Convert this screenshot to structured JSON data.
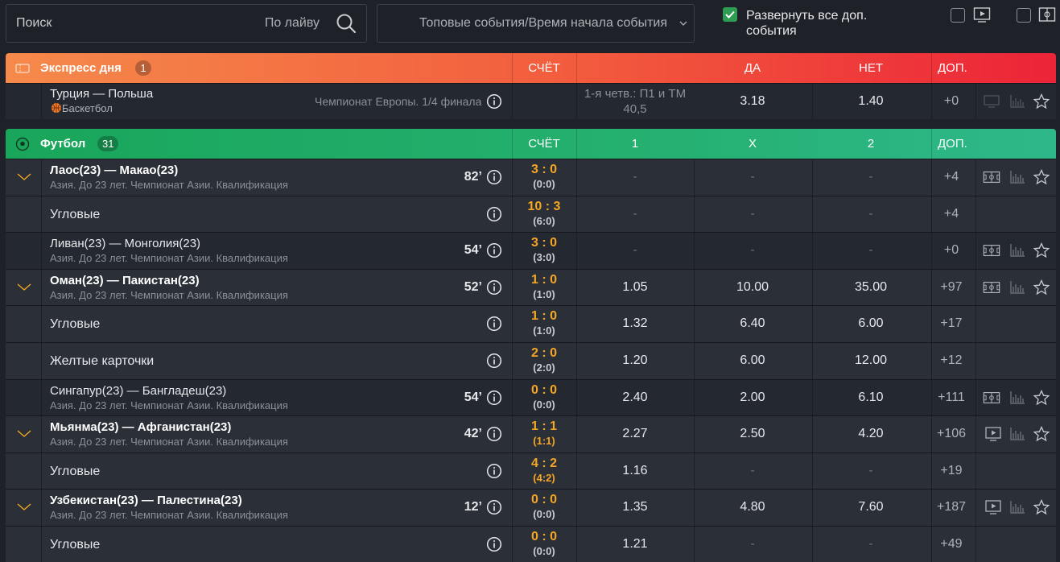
{
  "search": {
    "placeholder": "Поиск",
    "live_hint": "По лайву"
  },
  "sort": {
    "value": "Топовые события/Время начала события"
  },
  "expand": {
    "label_line1": "Развернуть все доп.",
    "label_line2": "события",
    "checked": true
  },
  "express": {
    "title": "Экспресс дня",
    "count": "1",
    "col_score": "СЧЁТ",
    "col_yes": "ДА",
    "col_no": "НЕТ",
    "col_more": "ДОП.",
    "event": {
      "teams": "Турция — Польша",
      "sport": "Баскетбол",
      "tournament": "Чемпионат Европы. 1/4 финала",
      "market_line1": "1-я четв.: П1 и ТМ",
      "market_line2": "40,5",
      "yes": "3.18",
      "no": "1.40",
      "more": "+0"
    }
  },
  "football": {
    "title": "Футбол",
    "count": "31",
    "col_score": "СЧЁТ",
    "col_1": "1",
    "col_x": "X",
    "col_2": "2",
    "col_more": "ДОП.",
    "rows": [
      {
        "type": "match",
        "teams": "Лаос(23) — Макао(23)",
        "league": "Азия. До 23 лет. Чемпионат Азии. Квалификация",
        "minute": "82’",
        "score": "3 : 0",
        "half": "(0:0)",
        "o1": "-",
        "ox": "-",
        "o2": "-",
        "more": "+4"
      },
      {
        "type": "sub",
        "label": "Угловые",
        "score": "10 : 3",
        "half": "(6:0)",
        "o1": "-",
        "ox": "-",
        "o2": "-",
        "more": "+4"
      },
      {
        "type": "match",
        "teams": "Ливан(23) — Монголия(23)",
        "league": "Азия. До 23 лет. Чемпионат Азии. Квалификация",
        "minute": "54’",
        "score": "3 : 0",
        "half": "(3:0)",
        "o1": "-",
        "ox": "-",
        "o2": "-",
        "more": "+0"
      },
      {
        "type": "match",
        "teams": "Оман(23) — Пакистан(23)",
        "league": "Азия. До 23 лет. Чемпионат Азии. Квалификация",
        "minute": "52’",
        "score": "1 : 0",
        "half": "(1:0)",
        "o1": "1.05",
        "ox": "10.00",
        "o2": "35.00",
        "more": "+97"
      },
      {
        "type": "sub",
        "label": "Угловые",
        "score": "1 : 0",
        "half": "(1:0)",
        "o1": "1.32",
        "ox": "6.40",
        "o2": "6.00",
        "more": "+17"
      },
      {
        "type": "sub",
        "label": "Желтые карточки",
        "score": "2 : 0",
        "half": "(2:0)",
        "o1": "1.20",
        "ox": "6.00",
        "o2": "12.00",
        "more": "+12"
      },
      {
        "type": "match",
        "teams": "Сингапур(23) — Бангладеш(23)",
        "league": "Азия. До 23 лет. Чемпионат Азии. Квалификация",
        "minute": "54’",
        "score": "0 : 0",
        "half": "(0:0)",
        "o1": "2.40",
        "ox": "2.00",
        "o2": "6.10",
        "more": "+111"
      },
      {
        "type": "match",
        "teams": "Мьянма(23) — Афганистан(23)",
        "league": "Азия. До 23 лет. Чемпионат Азии. Квалификация",
        "minute": "42’",
        "score": "1 : 1",
        "half": "(1:1)",
        "o1": "2.27",
        "ox": "2.50",
        "o2": "4.20",
        "more": "+106"
      },
      {
        "type": "sub",
        "label": "Угловые",
        "score": "4 : 2",
        "half": "(4:2)",
        "o1": "1.16",
        "ox": "-",
        "o2": "-",
        "more": "+19"
      },
      {
        "type": "match",
        "teams": "Узбекистан(23) — Палестина(23)",
        "league": "Азия. До 23 лет. Чемпионат Азии. Квалификация",
        "minute": "12’",
        "score": "0 : 0",
        "half": "(0:0)",
        "o1": "1.35",
        "ox": "4.80",
        "o2": "7.60",
        "more": "+187"
      },
      {
        "type": "sub",
        "label": "Угловые",
        "score": "0 : 0",
        "half": "(0:0)",
        "o1": "1.21",
        "ox": "-",
        "o2": "-",
        "more": "+49"
      }
    ]
  }
}
